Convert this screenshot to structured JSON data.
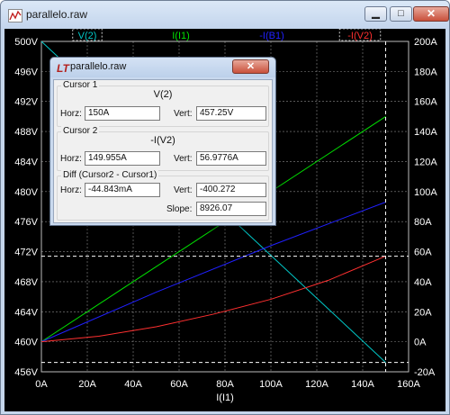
{
  "window": {
    "title": "parallelo.raw"
  },
  "caption_buttons": {
    "minimize": "▁",
    "maximize": "□",
    "close": "✕"
  },
  "legend": [
    {
      "label": "V(2)",
      "color": "#00c8c8"
    },
    {
      "label": "I(I1)",
      "color": "#00e000"
    },
    {
      "label": "-I(B1)",
      "color": "#2020ff"
    },
    {
      "label": "-I(V2)",
      "color": "#ff3030"
    }
  ],
  "chart_data": {
    "type": "line",
    "xlabel": "I(I1)",
    "x_ticks": [
      "0A",
      "20A",
      "40A",
      "60A",
      "80A",
      "100A",
      "120A",
      "140A",
      "160A"
    ],
    "x_range": [
      0,
      160
    ],
    "y_left_ticks": [
      "456V",
      "460V",
      "464V",
      "468V",
      "472V",
      "476V",
      "480V",
      "484V",
      "488V",
      "492V",
      "496V",
      "500V"
    ],
    "y_left_range": [
      456,
      500
    ],
    "y_right_ticks": [
      "-20A",
      "0A",
      "20A",
      "40A",
      "60A",
      "80A",
      "100A",
      "120A",
      "140A",
      "160A",
      "180A",
      "200A"
    ],
    "y_right_range": [
      -20,
      200
    ],
    "series": [
      {
        "name": "V(2)",
        "axis": "left",
        "color": "#00c8c8",
        "x": [
          0,
          150
        ],
        "y": [
          500,
          457.25
        ]
      },
      {
        "name": "I(I1)",
        "axis": "right",
        "color": "#00e000",
        "x": [
          0,
          150
        ],
        "y": [
          0,
          150
        ]
      },
      {
        "name": "-I(B1)",
        "axis": "right",
        "color": "#2020ff",
        "x": [
          0,
          50,
          100,
          150
        ],
        "y": [
          0,
          33,
          64,
          93
        ]
      },
      {
        "name": "-I(V2)",
        "axis": "right",
        "color": "#ff3030",
        "x": [
          0,
          25,
          50,
          75,
          100,
          125,
          150
        ],
        "y": [
          0,
          3.7,
          10,
          18.4,
          28.3,
          40.9,
          57
        ]
      }
    ],
    "cursors": {
      "cursor1_x": 150,
      "cursor1_y_left": 457.25,
      "cursor2_y_right": 56.9776
    }
  },
  "cursor_dialog": {
    "title": "parallelo.raw",
    "close": "✕",
    "cursor1": {
      "group": "Cursor 1",
      "trace": "V(2)",
      "horz_label": "Horz:",
      "horz": "150A",
      "vert_label": "Vert:",
      "vert": "457.25V"
    },
    "cursor2": {
      "group": "Cursor 2",
      "trace": "-I(V2)",
      "horz_label": "Horz:",
      "horz": "149.955A",
      "vert_label": "Vert:",
      "vert": "56.9776A"
    },
    "diff": {
      "group": "Diff (Cursor2 - Cursor1)",
      "horz_label": "Horz:",
      "horz": "-44.843mA",
      "vert_label": "Vert:",
      "vert": "-400.272",
      "slope_label": "Slope:",
      "slope": "8926.07"
    }
  }
}
